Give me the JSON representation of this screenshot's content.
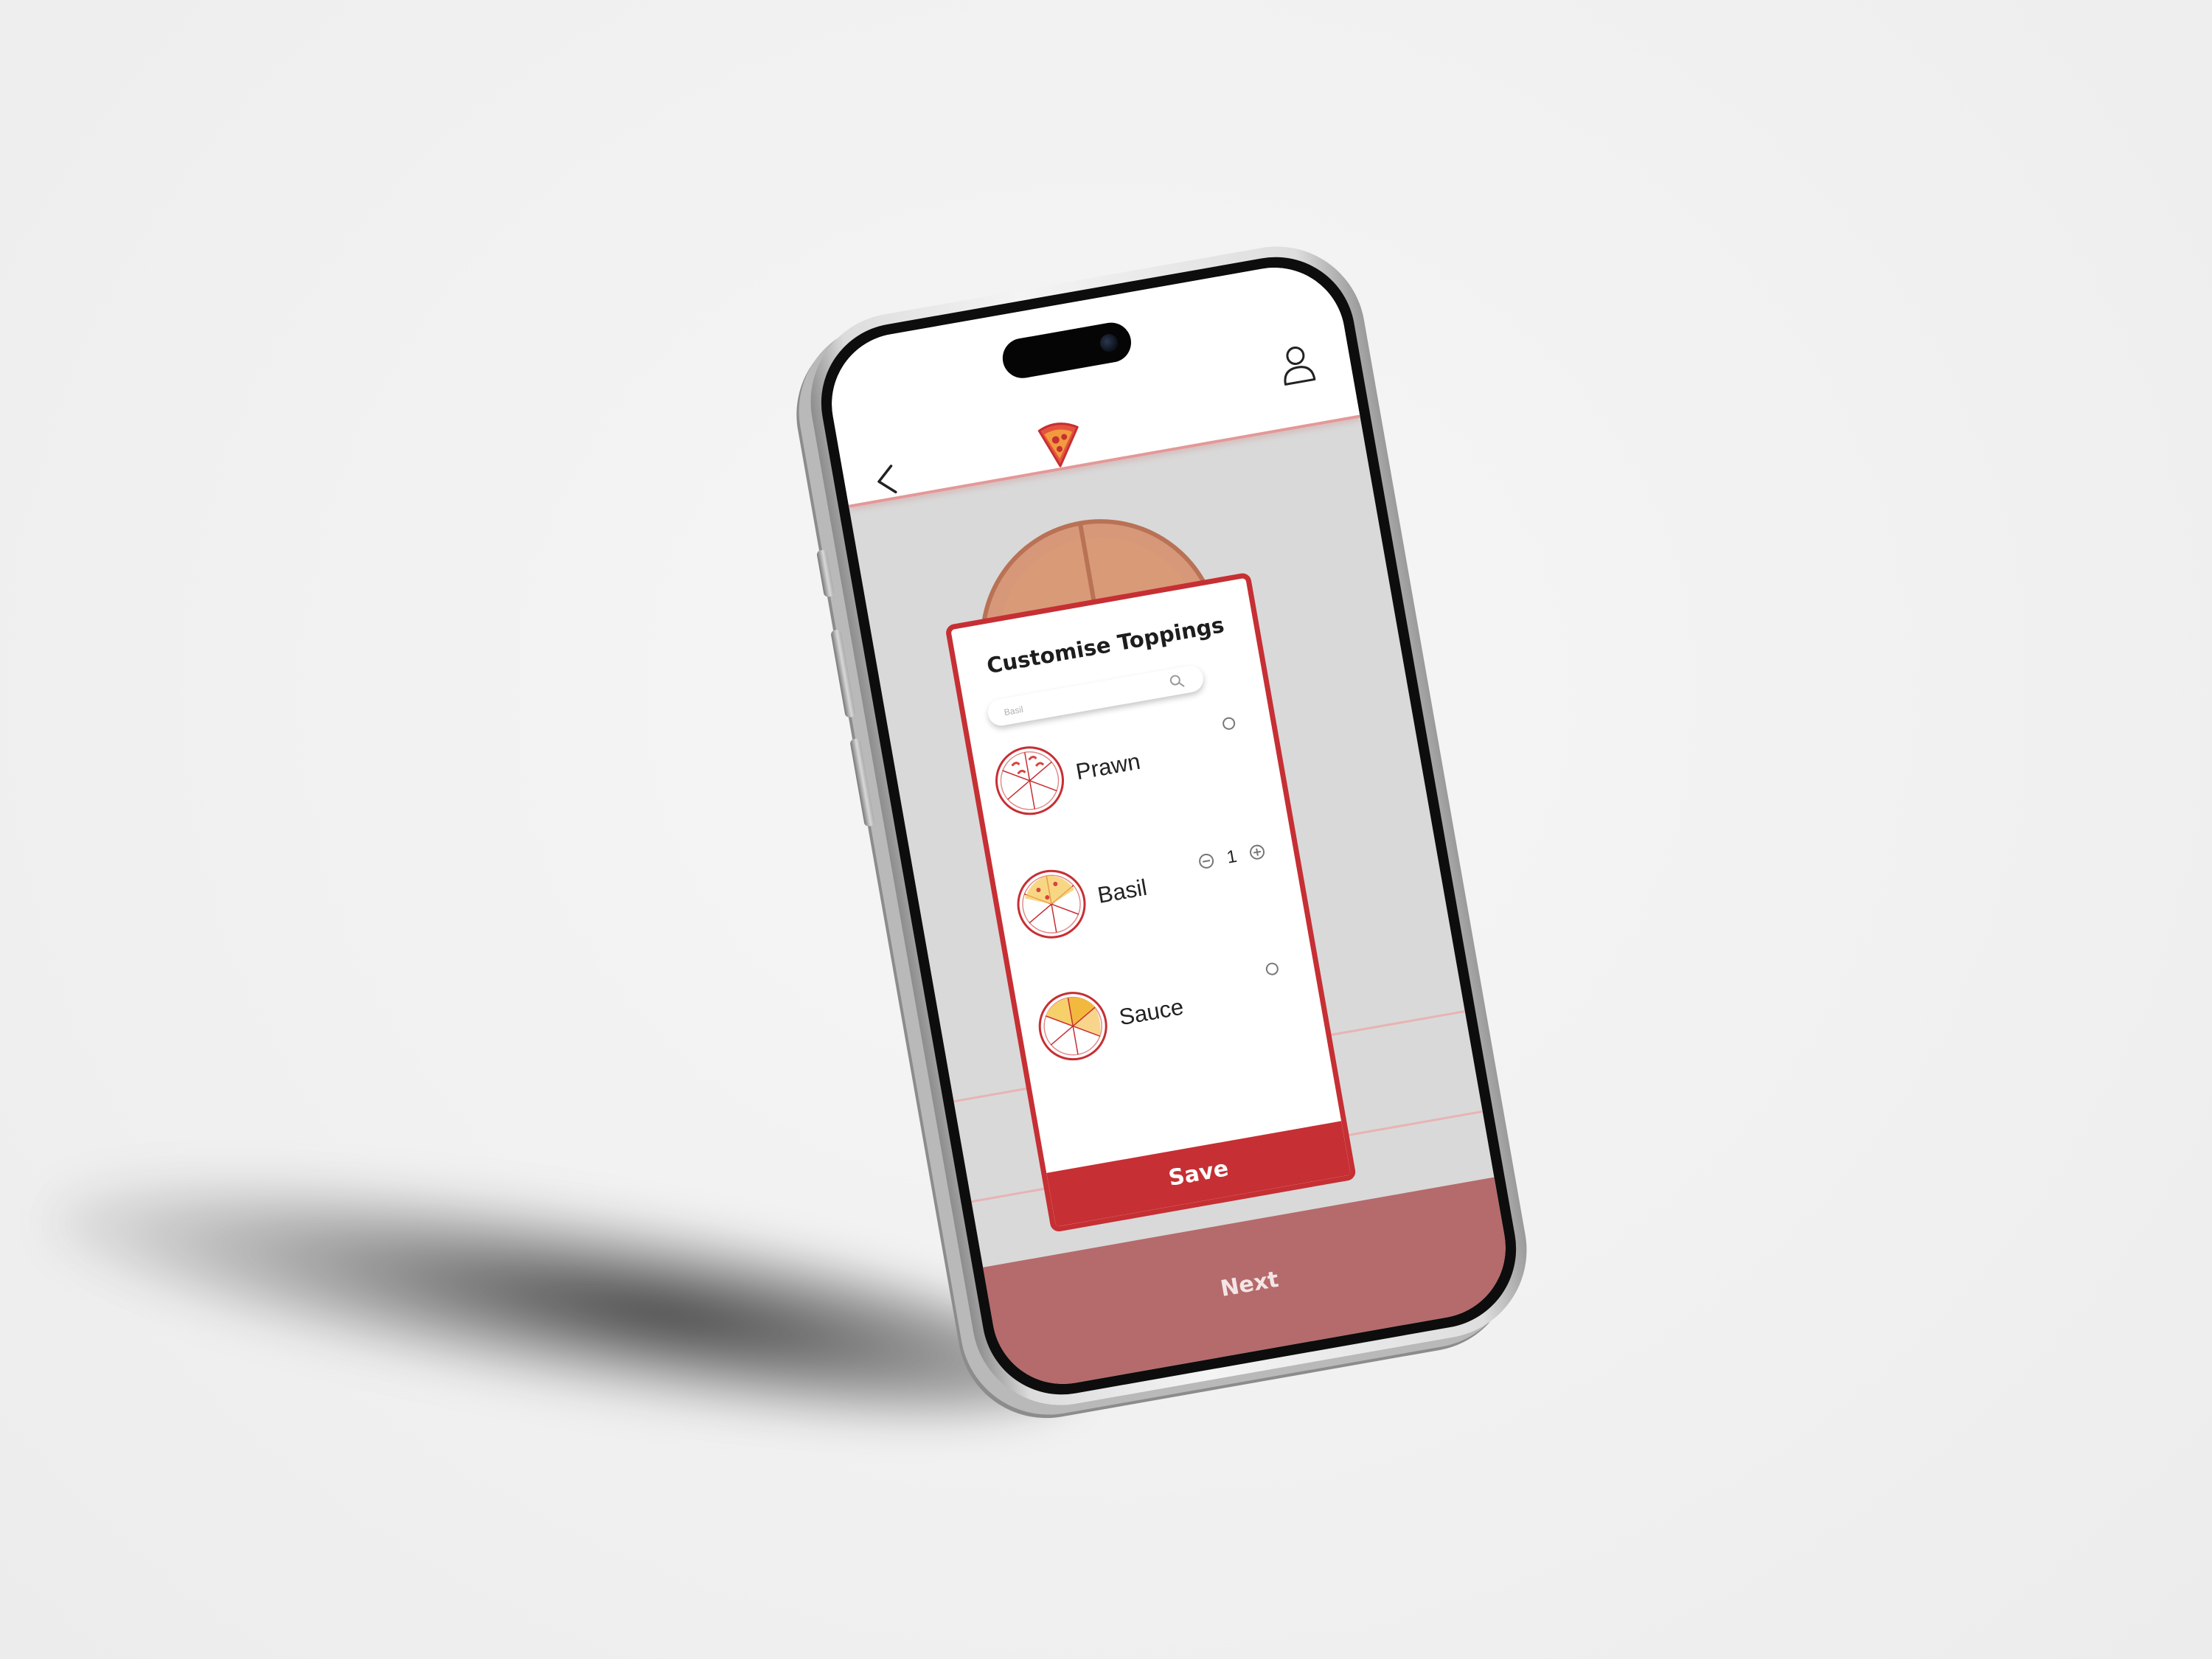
{
  "header": {
    "back_icon": "back-icon",
    "logo_icon": "pizza-slice-icon",
    "profile_icon": "user-icon"
  },
  "modal": {
    "title": "Customise Toppings",
    "search": {
      "value": "Basil",
      "icon": "search-icon"
    },
    "toppings": [
      {
        "name": "Prawn",
        "control": "radio",
        "selected": false
      },
      {
        "name": "Basil",
        "control": "stepper",
        "quantity": "1"
      },
      {
        "name": "Sauce",
        "control": "radio",
        "selected": false
      }
    ],
    "save_label": "Save"
  },
  "footer": {
    "next_label": "Next"
  },
  "colors": {
    "brand_red": "#c62f33",
    "muted_red": "#b56a6c",
    "background": "#f2f2f2",
    "screen_dim": "#d9d9d9"
  }
}
